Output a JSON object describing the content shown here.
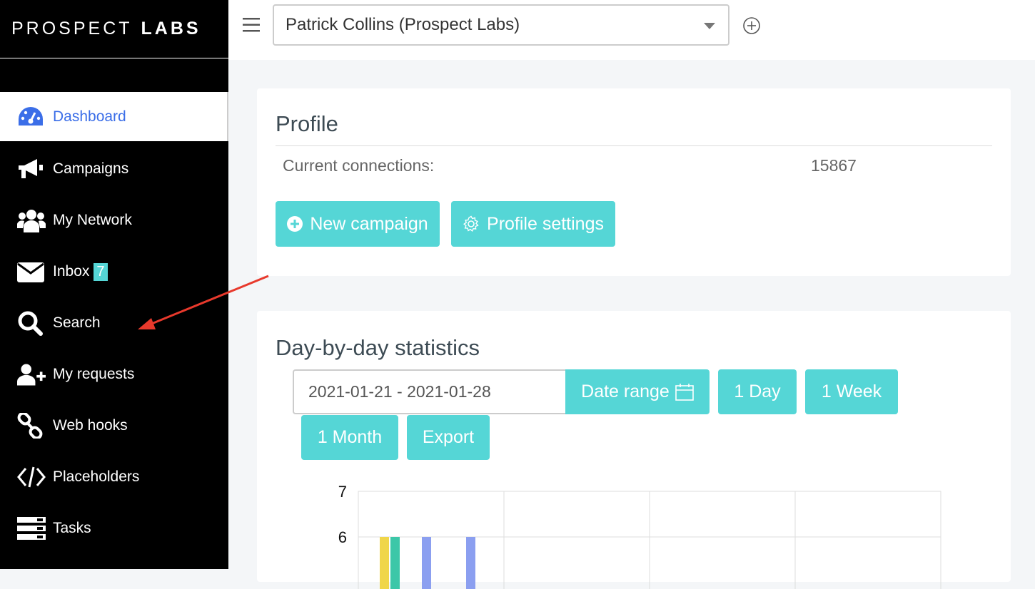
{
  "brand": {
    "light": "PROSPECT",
    "bold": "LABS"
  },
  "account_select": {
    "value": "Patrick Collins (Prospect Labs)"
  },
  "sidebar": {
    "items": [
      {
        "label": "Dashboard",
        "icon": "dashboard-gauge-icon",
        "active": true
      },
      {
        "label": "Campaigns",
        "icon": "megaphone-icon"
      },
      {
        "label": "My Network",
        "icon": "users-icon"
      },
      {
        "label": "Inbox",
        "icon": "envelope-icon",
        "badge": "7"
      },
      {
        "label": "Search",
        "icon": "search-icon"
      },
      {
        "label": "My requests",
        "icon": "user-plus-icon"
      },
      {
        "label": "Web hooks",
        "icon": "link-icon"
      },
      {
        "label": "Placeholders",
        "icon": "code-icon"
      },
      {
        "label": "Tasks",
        "icon": "server-icon"
      }
    ]
  },
  "profile": {
    "title": "Profile",
    "connections_label": "Current connections:",
    "connections_value": "15867",
    "new_campaign_label": "New campaign",
    "profile_settings_label": "Profile settings"
  },
  "stats": {
    "title": "Day-by-day statistics",
    "date_value": "2021-01-21 - 2021-01-28",
    "date_range_label": "Date range",
    "day_label": "1 Day",
    "week_label": "1 Week",
    "month_label": "1 Month",
    "export_label": "Export"
  },
  "chart_data": {
    "type": "bar",
    "y_ticks": [
      "7",
      "6"
    ],
    "ylim_visible": [
      6,
      7
    ],
    "series_colors": [
      "#f0d64a",
      "#3cc7a8",
      "#8b9ff0"
    ],
    "bars": [
      {
        "group": 0,
        "color": "#f0d64a",
        "value": 6
      },
      {
        "group": 0,
        "color": "#3cc7a8",
        "value": 6
      },
      {
        "group": 0,
        "color": "#8b9ff0",
        "value": 6
      },
      {
        "group": 1,
        "color": "#8b9ff0",
        "value": 6
      }
    ]
  },
  "annotation": {
    "arrow_color": "#e8392c"
  }
}
